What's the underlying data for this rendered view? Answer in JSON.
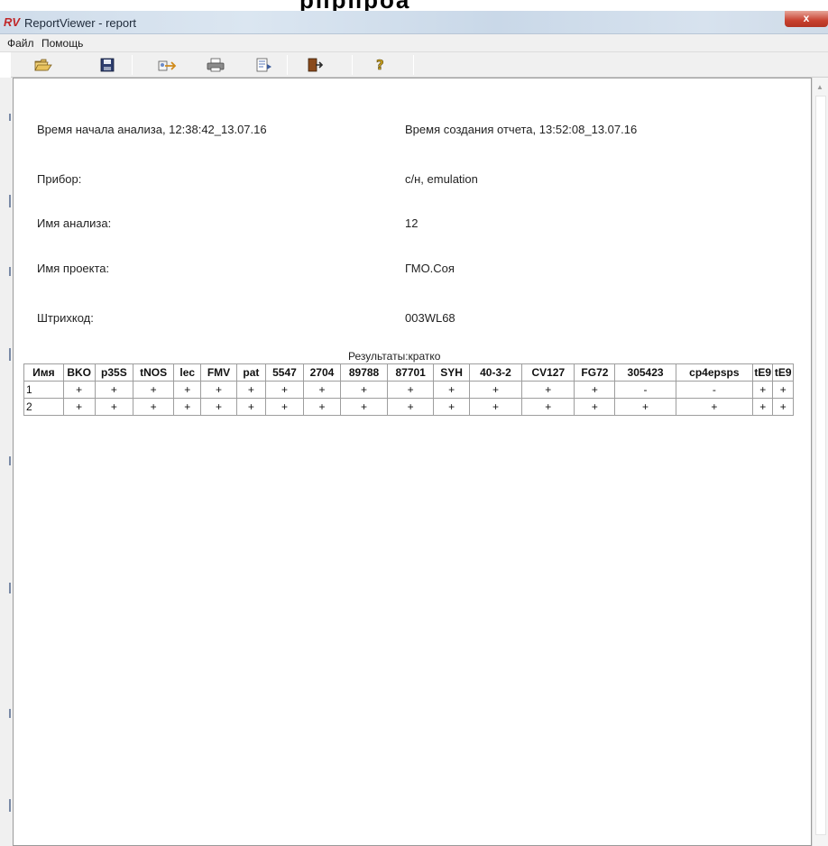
{
  "heading_fragment": "рпрпроа",
  "window": {
    "app_icon": "RV",
    "title": "ReportViewer - report",
    "close_label": "x"
  },
  "menu": [
    {
      "label": "Файл"
    },
    {
      "label": "Помощь"
    }
  ],
  "toolbar": {
    "buttons": [
      {
        "icon": "open-folder-icon"
      },
      {
        "icon": "save-disk-icon"
      },
      {
        "icon": "export-icon"
      },
      {
        "icon": "print-icon"
      },
      {
        "icon": "preview-icon"
      },
      {
        "icon": "exit-door-icon"
      },
      {
        "icon": "help-icon"
      }
    ]
  },
  "report": {
    "analysis_start": "Время начала анализа, 12:38:42_13.07.16",
    "report_created": "Время создания отчета, 13:52:08_13.07.16",
    "device_label": "Прибор:",
    "device_value": "с/н, emulation",
    "analysis_name_label": "Имя анализа:",
    "analysis_name_value": "12",
    "project_name_label": "Имя проекта:",
    "project_name_value": "ГМО.Соя",
    "barcode_label": "Штрихкод:",
    "barcode_value": "003WL68"
  },
  "results": {
    "caption": "Результаты:кратко",
    "columns": [
      "Имя",
      "BKO",
      "p35S",
      "tNOS",
      "lec",
      "FMV",
      "pat",
      "5547",
      "2704",
      "89788",
      "87701",
      "SYH",
      "40-3-2",
      "CV127",
      "FG72",
      "305423",
      "cp4epsps",
      "tE9",
      "tE9"
    ],
    "rows": [
      [
        "1",
        "+",
        "+",
        "+",
        "+",
        "+",
        "+",
        "+",
        "+",
        "+",
        "+",
        "+",
        "+",
        "+",
        "+",
        "-",
        "-",
        "+",
        "+"
      ],
      [
        "2",
        "+",
        "+",
        "+",
        "+",
        "+",
        "+",
        "+",
        "+",
        "+",
        "+",
        "+",
        "+",
        "+",
        "+",
        "+",
        "+",
        "+",
        "+"
      ]
    ]
  }
}
